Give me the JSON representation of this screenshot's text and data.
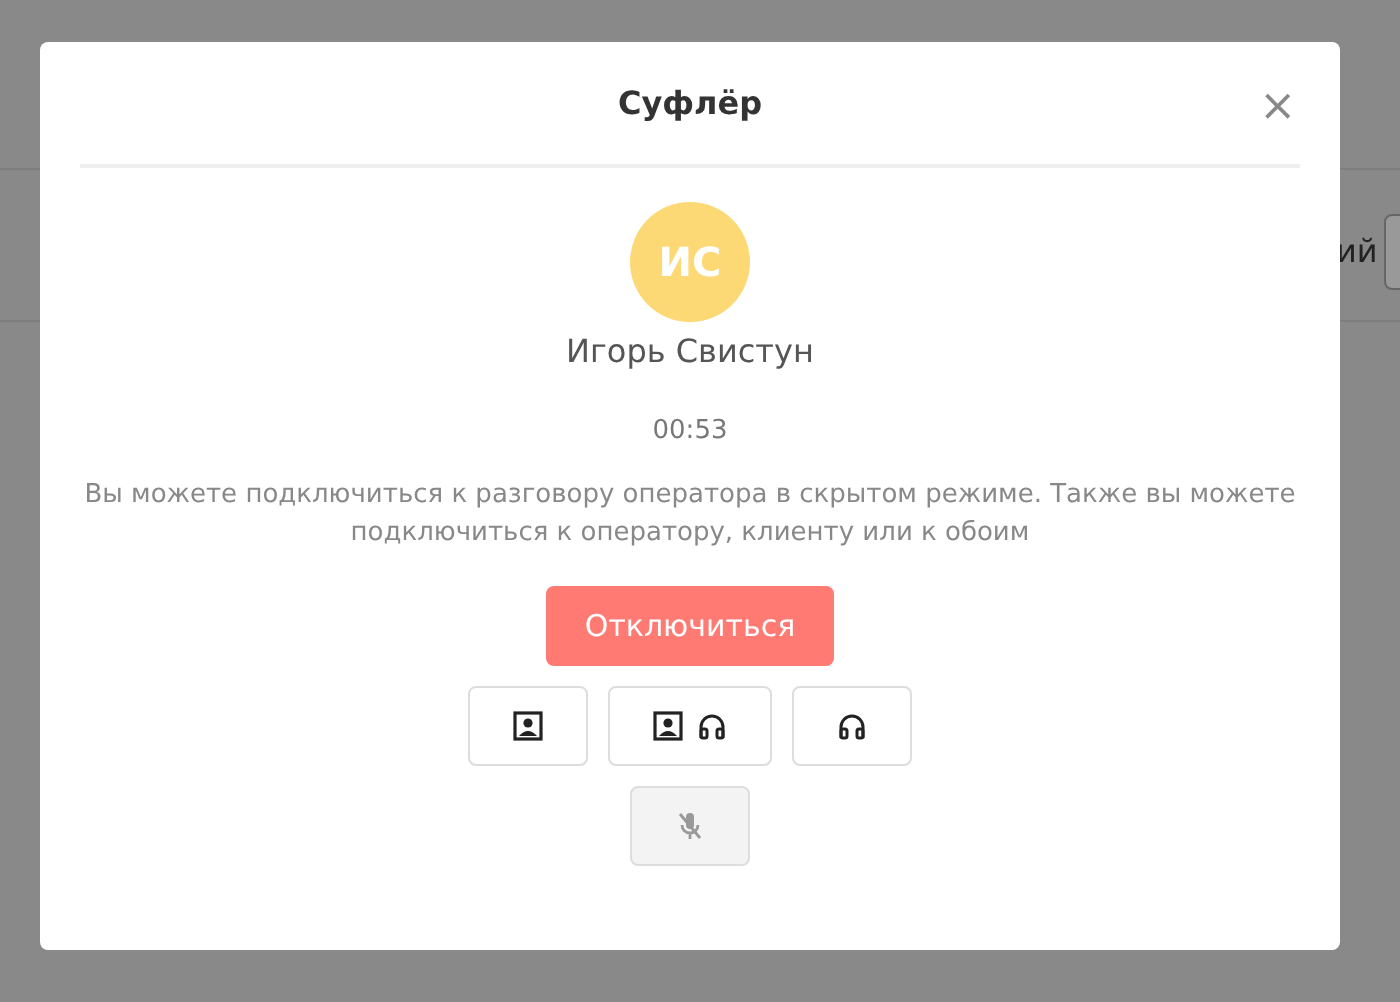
{
  "background": {
    "fragment": "ий"
  },
  "dialog": {
    "title": "Суфлёр",
    "close": "×"
  },
  "operator": {
    "initials": "ИС",
    "name": "Игорь Свистун",
    "color": "#fcd975"
  },
  "timer": "00:53",
  "description": "Вы можете подключиться к разговору оператора в скрытом режиме. Также вы можете подключиться к оператору, клиенту или к обоим",
  "disconnect_button": "Отключиться",
  "mode_buttons": [
    {
      "kind": "client",
      "disabled": false
    },
    {
      "kind": "both",
      "disabled": false
    },
    {
      "kind": "operator",
      "disabled": false
    }
  ],
  "mic_button": {
    "kind": "mic_off",
    "disabled": true
  }
}
